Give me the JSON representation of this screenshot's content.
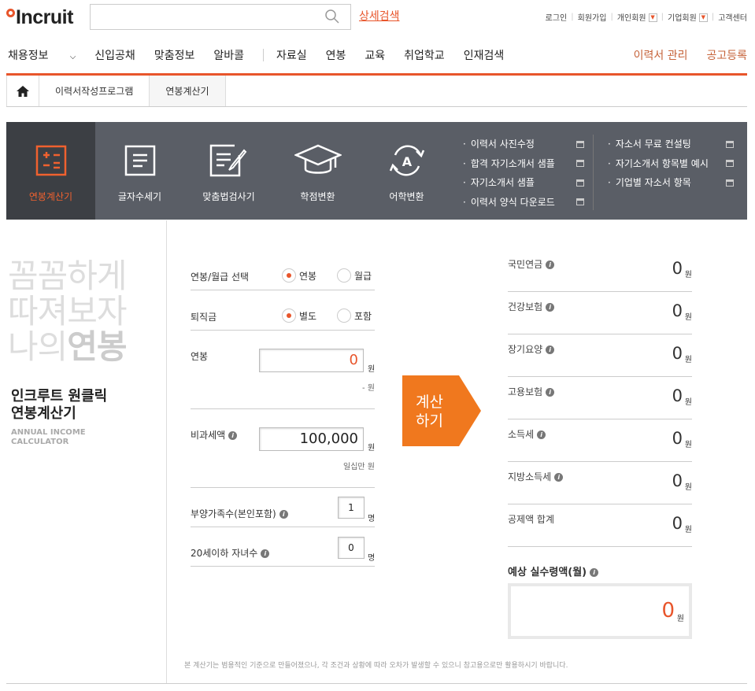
{
  "header": {
    "logo": "Incruit",
    "search_placeholder": "",
    "advanced_search": "상세검색",
    "top_links": [
      "로그인",
      "회원가입",
      "개인회원",
      "기업회원",
      "고객센터"
    ]
  },
  "gnb": {
    "items_left": [
      "채용정보",
      "신입공채",
      "맞춤정보",
      "알바콜"
    ],
    "items_mid": [
      "자료실",
      "연봉",
      "교육",
      "취업학교",
      "인재검색"
    ],
    "items_right": [
      "이력서 관리",
      "공고등록"
    ]
  },
  "breadcrumb": [
    "이력서작성프로그램",
    "연봉계산기"
  ],
  "toolbar": {
    "tools": [
      "연봉계산기",
      "글자수세기",
      "맞춤법검사기",
      "학점변환",
      "어학변환"
    ],
    "links_col1": [
      "이력서 사진수정",
      "합격 자기소개서 샘플",
      "자기소개서 샘플",
      "이력서 양식 다운로드"
    ],
    "links_col2": [
      "자소서 무료 컨설팅",
      "자기소개서 항목별 예시",
      "기업별 자소서 항목"
    ]
  },
  "side": {
    "big_lines": [
      "꼼꼼하게",
      "따져보자",
      "나의"
    ],
    "big_bold": "연봉",
    "app_name_1": "인크루트 원클릭",
    "app_name_2": "연봉계산기",
    "app_en_1": "ANNUAL INCOME",
    "app_en_2": "CALCULATOR"
  },
  "form": {
    "pay_type_label": "연봉/월급 선택",
    "pay_opt1": "연봉",
    "pay_opt2": "월급",
    "severance_label": "퇴직금",
    "sev_opt1": "별도",
    "sev_opt2": "포함",
    "salary_label": "연봉",
    "salary_value": "0",
    "salary_unit": "원",
    "salary_korean": "- 원",
    "nontax_label": "비과세액",
    "nontax_value": "100,000",
    "nontax_unit": "원",
    "nontax_korean": "일십만 원",
    "dependents_label": "부양가족수(본인포함)",
    "dependents_value": "1",
    "children_label": "20세이하 자녀수",
    "children_value": "0",
    "person_unit": "명",
    "calc_button_1": "계산",
    "calc_button_2": "하기"
  },
  "results": {
    "rows": [
      {
        "label": "국민연금",
        "value": "0",
        "info": true
      },
      {
        "label": "건강보험",
        "value": "0",
        "info": true
      },
      {
        "label": "장기요양",
        "value": "0",
        "info": true
      },
      {
        "label": "고용보험",
        "value": "0",
        "info": true
      },
      {
        "label": "소득세",
        "value": "0",
        "info": true
      },
      {
        "label": "지방소득세",
        "value": "0",
        "info": true
      },
      {
        "label": "공제액 합계",
        "value": "0",
        "info": false
      }
    ],
    "unit": "원",
    "final_label": "예상 실수령액(월)",
    "final_value": "0"
  },
  "note": "본 계산기는 범용적인 기준으로 만들어졌으나, 각 조건과 상황에 따라 오차가 발생할 수 있으니 참고용으로만 활용하시기 바랍니다."
}
